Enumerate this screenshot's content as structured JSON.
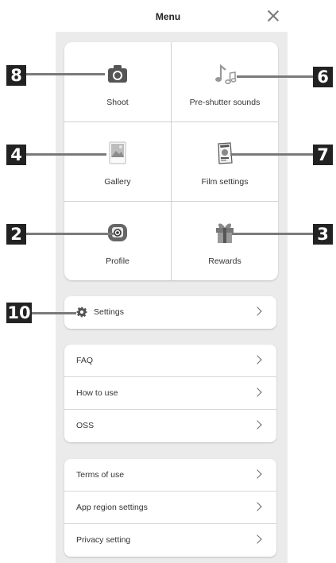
{
  "header": {
    "title": "Menu",
    "close_icon": "close-icon"
  },
  "grid": [
    {
      "label": "Shoot",
      "icon": "camera-icon"
    },
    {
      "label": "Pre-shutter sounds",
      "icon": "music-note-icon"
    },
    {
      "label": "Gallery",
      "icon": "gallery-icon"
    },
    {
      "label": "Film settings",
      "icon": "film-pack-icon"
    },
    {
      "label": "Profile",
      "icon": "instax-camera-icon"
    },
    {
      "label": "Rewards",
      "icon": "gift-icon"
    }
  ],
  "settings": {
    "label": "Settings",
    "icon": "gear-icon"
  },
  "help_list": [
    {
      "label": "FAQ"
    },
    {
      "label": "How to use"
    },
    {
      "label": "OSS"
    }
  ],
  "legal_list": [
    {
      "label": "Terms of use"
    },
    {
      "label": "App region settings"
    },
    {
      "label": "Privacy setting"
    }
  ],
  "callouts": {
    "shoot": "8",
    "sounds": "6",
    "gallery": "4",
    "film": "7",
    "profile": "2",
    "rewards": "3",
    "settings": "10"
  }
}
